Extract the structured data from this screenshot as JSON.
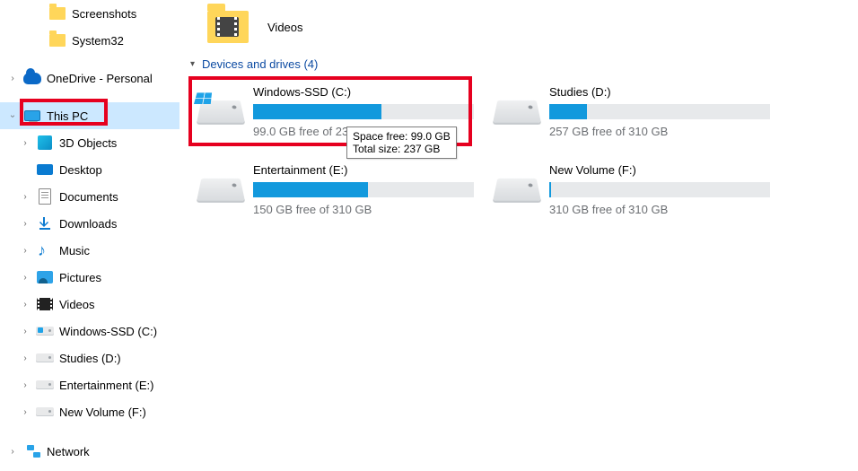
{
  "nav": {
    "items": [
      {
        "label": "Screenshots",
        "icon": "folder",
        "indent": 3,
        "chev": "blank"
      },
      {
        "label": "System32",
        "icon": "folder",
        "indent": 3,
        "chev": "blank"
      },
      {
        "label": "OneDrive - Personal",
        "icon": "onedrive",
        "indent": 1,
        "chev": "closed"
      },
      {
        "label": "This PC",
        "icon": "thispc",
        "indent": 1,
        "chev": "open",
        "selected": true,
        "redbox": true
      },
      {
        "label": "3D Objects",
        "icon": "3d",
        "indent": 2,
        "chev": "closed"
      },
      {
        "label": "Desktop",
        "icon": "desktop",
        "indent": 2,
        "chev": "blank"
      },
      {
        "label": "Documents",
        "icon": "documents",
        "indent": 2,
        "chev": "closed"
      },
      {
        "label": "Downloads",
        "icon": "downloads",
        "indent": 2,
        "chev": "closed"
      },
      {
        "label": "Music",
        "icon": "music",
        "indent": 2,
        "chev": "closed"
      },
      {
        "label": "Pictures",
        "icon": "pictures",
        "indent": 2,
        "chev": "closed"
      },
      {
        "label": "Videos",
        "icon": "videosnav",
        "indent": 2,
        "chev": "closed"
      },
      {
        "label": "Windows-SSD (C:)",
        "icon": "drivewin",
        "indent": 2,
        "chev": "closed"
      },
      {
        "label": "Studies (D:)",
        "icon": "drive",
        "indent": 2,
        "chev": "closed"
      },
      {
        "label": "Entertainment (E:)",
        "icon": "drive",
        "indent": 2,
        "chev": "closed"
      },
      {
        "label": "New Volume (F:)",
        "icon": "drive",
        "indent": 2,
        "chev": "closed"
      },
      {
        "label": "Network",
        "icon": "network",
        "indent": 1,
        "chev": "closed"
      }
    ]
  },
  "content": {
    "folder_above": {
      "label": "Videos"
    },
    "section_header": "Devices and drives (4)",
    "drives": [
      {
        "name": "Windows-SSD (C:)",
        "free_text": "99.0 GB free of 237 GB",
        "fill_pct": 58,
        "win": true,
        "redbox": true,
        "tooltip": {
          "line1": "Space free: 99.0 GB",
          "line2": "Total size: 237 GB"
        }
      },
      {
        "name": "Studies (D:)",
        "free_text": "257 GB free of 310 GB",
        "fill_pct": 17,
        "win": false
      },
      {
        "name": "Entertainment (E:)",
        "free_text": "150 GB free of 310 GB",
        "fill_pct": 52,
        "win": false
      },
      {
        "name": "New Volume (F:)",
        "free_text": "310 GB free of 310 GB",
        "fill_pct": 1,
        "win": false
      }
    ]
  }
}
